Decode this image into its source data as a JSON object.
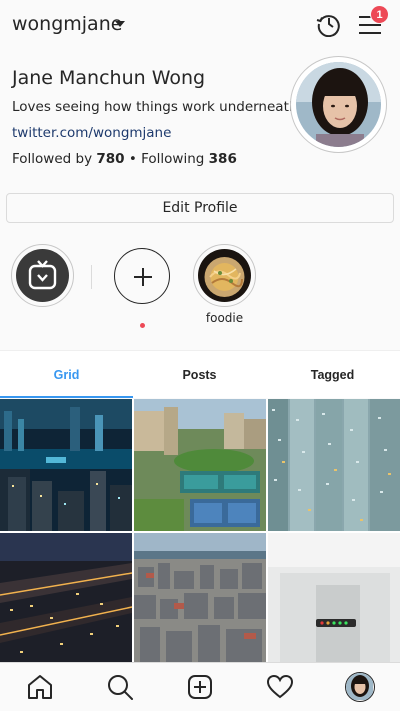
{
  "header": {
    "username": "wongmjane",
    "notification_count": "1",
    "icons": [
      "chevron-down-icon",
      "history-icon",
      "menu-icon"
    ]
  },
  "profile": {
    "name": "Jane Manchun Wong",
    "bio": "Loves seeing how things work underneath",
    "link": "twitter.com/wongmjane",
    "followed_by_label": "Followed by",
    "followers": "780",
    "separator": "•",
    "following_label": "Following",
    "following": "386"
  },
  "edit_profile_label": "Edit Profile",
  "highlights": [
    {
      "label": "",
      "icon": "igtv-icon"
    },
    {
      "label": "",
      "icon": "plus-icon"
    },
    {
      "label": "foodie",
      "icon": "noodles-image"
    }
  ],
  "tabs": [
    {
      "label": "Grid",
      "active": true
    },
    {
      "label": "Posts",
      "active": false
    },
    {
      "label": "Tagged",
      "active": false
    }
  ],
  "grid_items": [
    "city-night-harbour",
    "racecourse-aerial",
    "apartment-towers",
    "city-night-street",
    "city-skyline-day",
    "white-room-sign"
  ],
  "bottom_nav": [
    "home-icon",
    "search-icon",
    "add-post-icon",
    "heart-icon",
    "profile-avatar"
  ],
  "colors": {
    "accent": "#3897f0",
    "badge": "#ed4956",
    "link": "#1e3a6d"
  }
}
